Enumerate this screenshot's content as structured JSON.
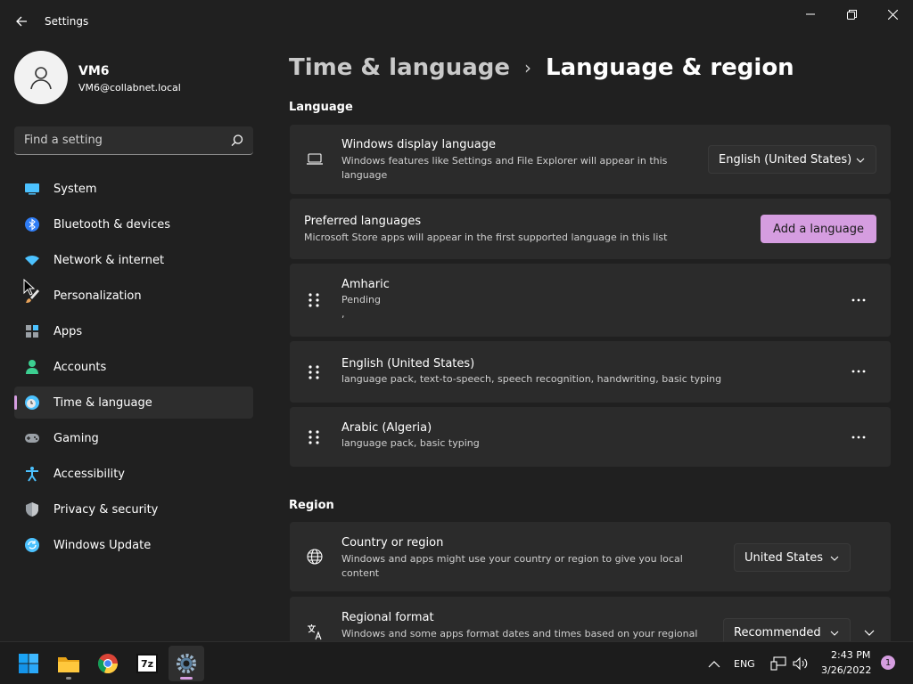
{
  "window": {
    "title": "Settings"
  },
  "profile": {
    "name": "VM6",
    "email": "VM6@collabnet.local"
  },
  "search": {
    "placeholder": "Find a setting"
  },
  "sidebar": {
    "items": [
      {
        "label": "System",
        "icon": "system-display-icon",
        "color": "#4cc2ff"
      },
      {
        "label": "Bluetooth & devices",
        "icon": "bluetooth-icon",
        "color": "#2f7df6"
      },
      {
        "label": "Network & internet",
        "icon": "wifi-icon",
        "color": "#4cc2ff"
      },
      {
        "label": "Personalization",
        "icon": "paintbrush-icon",
        "color": "#e8a35a"
      },
      {
        "label": "Apps",
        "icon": "apps-icon",
        "color": "#9aa0a6"
      },
      {
        "label": "Accounts",
        "icon": "person-icon",
        "color": "#3ccf91"
      },
      {
        "label": "Time & language",
        "icon": "clock-globe-icon",
        "color": "#4cc2ff",
        "active": true
      },
      {
        "label": "Gaming",
        "icon": "gamepad-icon",
        "color": "#9aa0a6"
      },
      {
        "label": "Accessibility",
        "icon": "accessibility-icon",
        "color": "#4cc2ff"
      },
      {
        "label": "Privacy & security",
        "icon": "shield-icon",
        "color": "#9aa0a6"
      },
      {
        "label": "Windows Update",
        "icon": "update-icon",
        "color": "#4cc2ff"
      }
    ]
  },
  "breadcrumb": {
    "parent": "Time & language",
    "separator": "›",
    "current": "Language & region"
  },
  "language_section": {
    "title": "Language",
    "display_language": {
      "title": "Windows display language",
      "subtitle": "Windows features like Settings and File Explorer will appear in this language",
      "value": "English (United States)"
    },
    "preferred": {
      "title": "Preferred languages",
      "subtitle": "Microsoft Store apps will appear in the first supported language in this list",
      "button": "Add a language"
    },
    "languages": [
      {
        "name": "Amharic",
        "status": "Pending",
        "extra": ","
      },
      {
        "name": "English (United States)",
        "status": "language pack, text-to-speech, speech recognition, handwriting, basic typing",
        "extra": ""
      },
      {
        "name": "Arabic (Algeria)",
        "status": "language pack, basic typing",
        "extra": ""
      }
    ]
  },
  "region_section": {
    "title": "Region",
    "country": {
      "title": "Country or region",
      "subtitle": "Windows and apps might use your country or region to give you local content",
      "value": "United States"
    },
    "format": {
      "title": "Regional format",
      "subtitle": "Windows and some apps format dates and times based on your regional",
      "value": "Recommended"
    }
  },
  "taskbar": {
    "apps": [
      "start-icon",
      "file-explorer-icon",
      "chrome-icon",
      "7zip-icon",
      "settings-icon"
    ],
    "zip_label": "7z",
    "lang": "ENG",
    "time": "2:43 PM",
    "date": "3/26/2022",
    "notifications": "1"
  },
  "colors": {
    "accent": "#d59de0",
    "background": "#202020",
    "card": "#2b2b2b"
  }
}
